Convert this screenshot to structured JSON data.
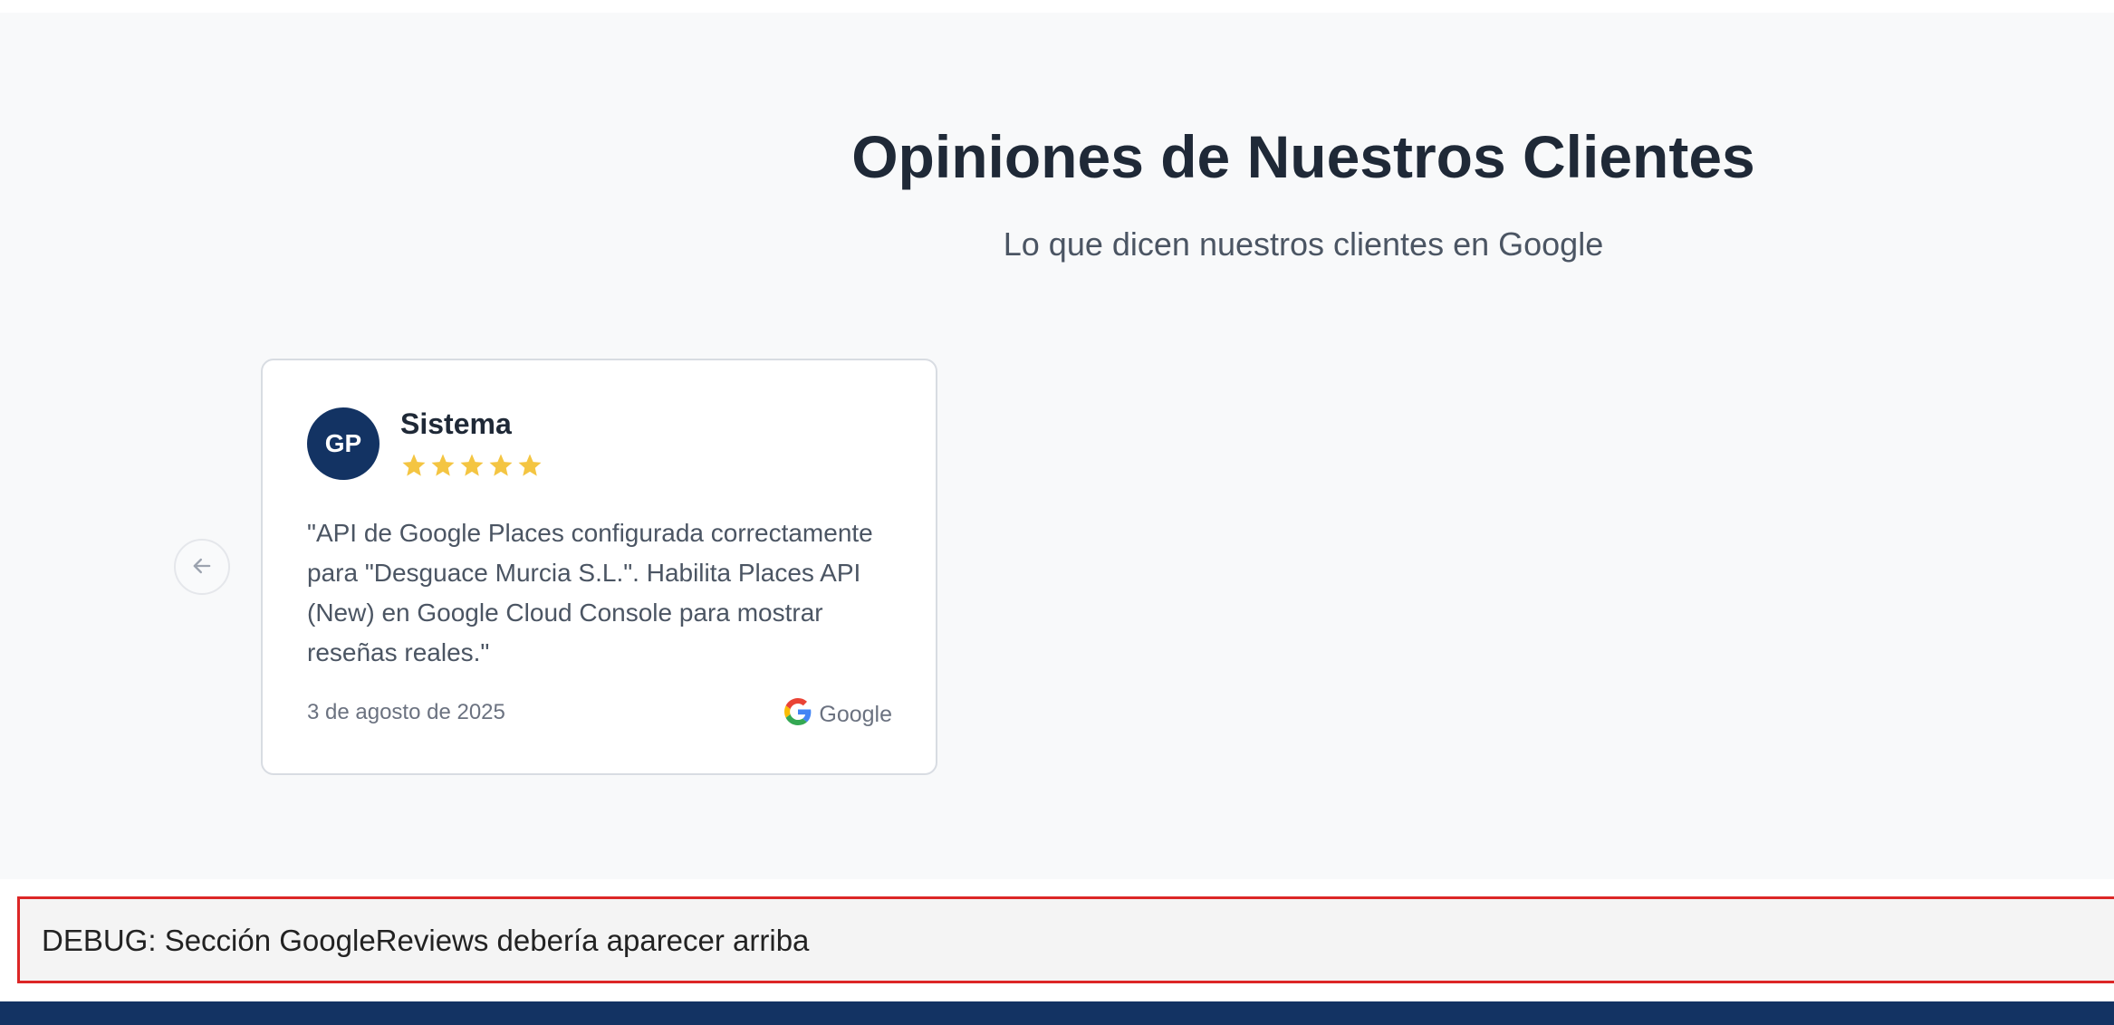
{
  "section": {
    "title": "Opiniones de Nuestros Clientes",
    "subtitle": "Lo que dicen nuestros clientes en Google"
  },
  "carousel": {
    "prev_icon": "arrow-left-icon"
  },
  "review": {
    "avatar_initials": "GP",
    "author": "Sistema",
    "rating": 5,
    "rating_max": 5,
    "star_color": "#f4c542",
    "text": "\"API de Google Places configurada correctamente para \"Desguace Murcia S.L.\". Habilita Places API (New) en Google Cloud Console para mostrar reseñas reales.\"",
    "date": "3 de agosto de 2025",
    "source_label": "Google",
    "source_icon": "google-icon"
  },
  "debug": {
    "message": "DEBUG: Sección GoogleReviews debería aparecer arriba"
  },
  "colors": {
    "brand_navy": "#133363",
    "section_bg": "#f8f9fa",
    "debug_border": "#dc2626"
  }
}
